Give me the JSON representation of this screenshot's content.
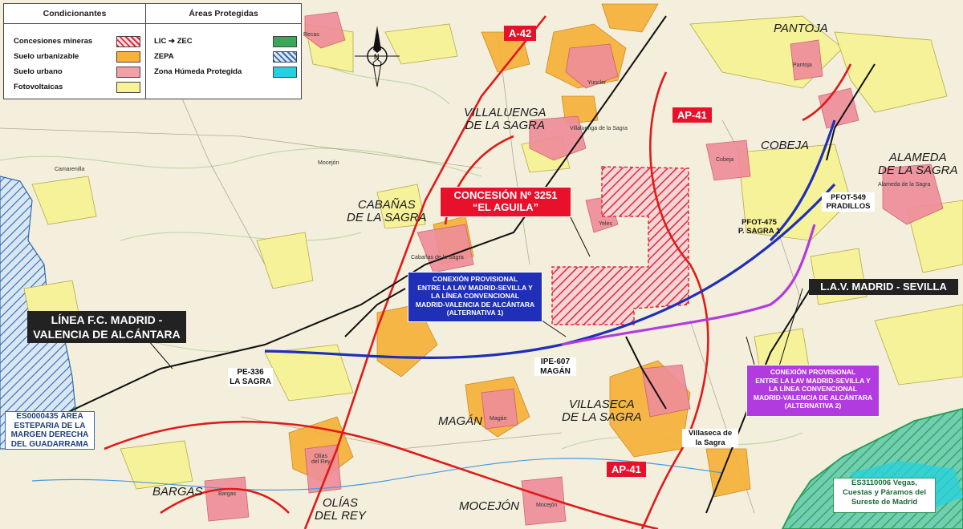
{
  "legend": {
    "left_header": "Condicionantes",
    "right_header": "Áreas Protegidas",
    "left_items": [
      {
        "label": "Concesiones mineras",
        "swatch": "hatch-red"
      },
      {
        "label": "Suelo urbanizable",
        "swatch": "#f6b23a"
      },
      {
        "label": "Suelo urbano",
        "swatch": "#f2a0a8"
      },
      {
        "label": "Fotovoltaicas",
        "swatch": "#f6f29a"
      }
    ],
    "right_items": [
      {
        "label": "LIC",
        "arrow": "➔",
        "label2": "ZEC",
        "swatch": "#3aa65a"
      },
      {
        "label": "ZEPA",
        "swatch": "hatch-blue"
      },
      {
        "label": "Zona Húmeda Protegida",
        "swatch": "#24d1e0"
      }
    ]
  },
  "colors": {
    "background": "#f3efdc",
    "road_red": "#e01a1a",
    "rail_black": "#111111",
    "lav_blue": "#1f2fb8",
    "alt2_purple": "#b23be0",
    "urbanizable": "#f6b23a",
    "urban": "#ef8c9a",
    "solar": "#f6f29a",
    "zec_green": "#2e9e58",
    "zepa_blue": "#2f6bb0"
  },
  "roads": {
    "a42": "A-42",
    "ap41_north": "AP-41",
    "ap41_south": "AP-41"
  },
  "places": {
    "pantoja": "PANTOJA",
    "villaluenga": "VILLALUENGA\nDE LA SAGRA",
    "cobeja": "COBEJA",
    "alameda": "ALAMEDA\nDE LA SAGRA",
    "cabanas": "CABAÑAS\nDE LA SAGRA",
    "villaseca": "VILLASECA\nDE LA SAGRA",
    "magan": "MAGÁN",
    "bargas": "BARGAS",
    "olias": "OLÍAS\nDEL REY",
    "mocejon": "MOCEJÓN"
  },
  "small_labels": {
    "recas": "Recas",
    "yuncler": "Yuncler",
    "pantoja_small": "Pantoja",
    "villaluenga_small": "Villaluenga de la Sagra",
    "cobeja_small": "Cobeja",
    "alameda_small": "Alameda de la Sagra",
    "yeles": "Yeles",
    "cabanas_small": "Cabañas de la Sagra",
    "magan_small": "Magán",
    "olias_small": "Olías\ndel Rey",
    "bargas_small": "Bargas",
    "mocejon_small": "Mocejón",
    "camarenilla": "Camarenilla",
    "mocejon2": "Mocejón"
  },
  "concession": {
    "title": "CONCESIÓN Nº 3251",
    "name": "“EL AGUILA”"
  },
  "rail_line_label": "LÍNEA F.C. MADRID -\nVALENCIA DE ALCÁNTARA",
  "lav_label": "L.A.V. MADRID - SEVILLA",
  "connection_alt1": "CONEXIÓN PROVISIONAL\nENTRE LA LAV MADRID-SEVILLA Y\nLA LÍNEA CONVENCIONAL\nMADRID-VALENCIA DE ALCÁNTARA\n(ALTERNATIVA 1)",
  "connection_alt2": "CONEXIÓN PROVISIONAL\nENTRE LA LAV MADRID-SEVILLA Y\nLA LÍNEA CONVENCIONAL\nMADRID-VALENCIA DE ALCÁNTARA\n(ALTERNATIVA 2)",
  "plants": {
    "pfot549": "PFOT-549\nPRADILLOS",
    "pfot475": "PFOT-475\nP. SAGRA 1",
    "ipe607": "IPE-607\nMAGÁN",
    "pe336": "PE-336\nLA SAGRA",
    "villaseca_box": "Villaseca de\nla Sagra"
  },
  "protected": {
    "zepa_es0000435": "ES0000435 ÁREA\nESTEPARIA DE LA\nMARGEN DERECHA\nDEL GUADARRAMA",
    "zec_es3110006": "ES3110006 Vegas,\nCuestas y Páramos del\nSureste de Madrid"
  }
}
